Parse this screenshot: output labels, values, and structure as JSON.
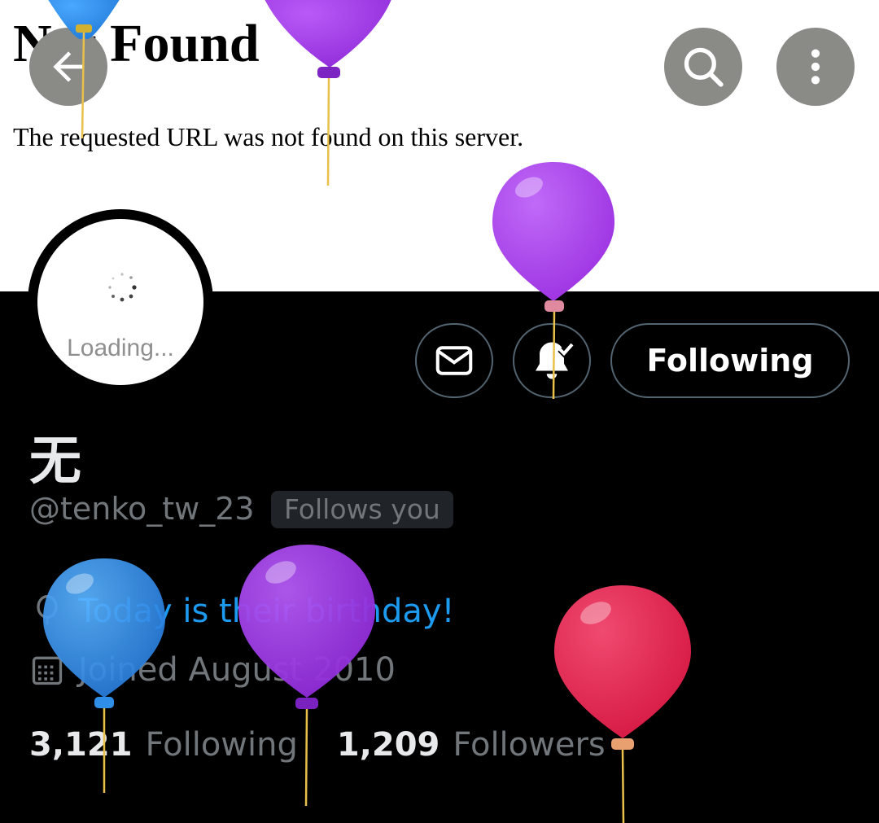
{
  "banner": {
    "title": "Not Found",
    "message": "The requested URL was not found on this server."
  },
  "header": {
    "back_icon": "arrow-left-icon",
    "search_icon": "search-icon",
    "more_icon": "more-vertical-icon"
  },
  "avatar": {
    "loading_text": "Loading..."
  },
  "actions": {
    "message_icon": "envelope-icon",
    "notify_icon": "bell-check-icon",
    "following_label": "Following"
  },
  "profile": {
    "name": "无",
    "handle": "@tenko_tw_23",
    "follows_you": "Follows you",
    "birthday_text": "Today is their birthday!",
    "joined_text": "Joined August 2010"
  },
  "stats": {
    "following_count": "3,121",
    "following_label": "Following",
    "followers_count": "1,209",
    "followers_label": "Followers"
  },
  "colors": {
    "accent": "#1d9bf0",
    "balloon_blue": "#2d8ae6",
    "balloon_purple": "#9b30e0",
    "balloon_red": "#e0204a"
  }
}
